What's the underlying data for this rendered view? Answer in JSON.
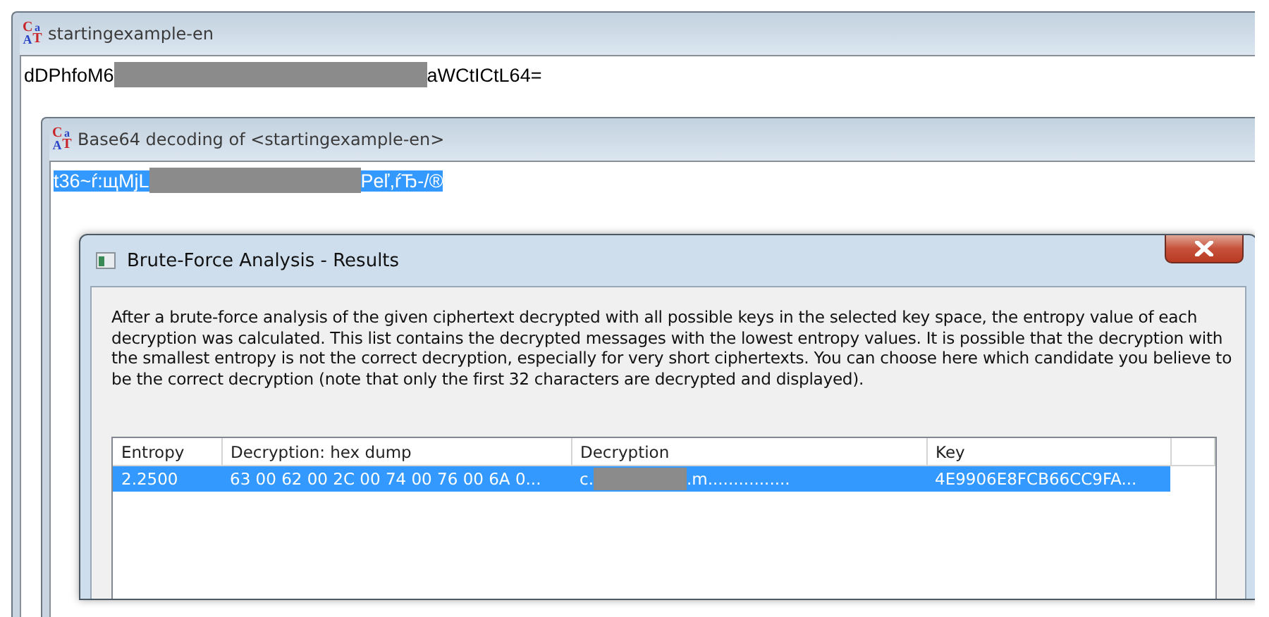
{
  "main_window": {
    "icon_letters": [
      "C",
      "a",
      "A",
      "T"
    ],
    "title": "startingexample-en",
    "content": {
      "kind": "redacted",
      "start": "dDPhfoM6",
      "end": "aWCtICtL64=",
      "selected": false
    }
  },
  "decoding_window": {
    "icon_letters": [
      "C",
      "a",
      "A",
      "T"
    ],
    "title": "Base64 decoding of <startingexample-en>",
    "content": {
      "kind": "redacted",
      "start": "t36~ŕ:щMjL",
      "end": "Peľ,ŕЂ-/®",
      "selected": true
    }
  },
  "dialog": {
    "title": "Brute-Force Analysis - Results",
    "description": "After a brute-force analysis of the given ciphertext decrypted with all possible keys in the selected key space, the entropy value of each decryption was calculated. This list contains the decrypted messages with the lowest entropy values. It is possible that the decryption with the smallest entropy is not the correct decryption, especially for very short ciphertexts. You can choose here which candidate you believe to be the correct decryption (note that only the first 32 characters are decrypted and displayed).",
    "table": {
      "columns": [
        "Entropy",
        "Decryption: hex dump",
        "Decryption",
        "Key"
      ],
      "rows": [
        {
          "selected": true,
          "cells": [
            {
              "kind": "text",
              "text": "2.2500"
            },
            {
              "kind": "text",
              "text": "63 00 62 00 2C 00 74 00 76 00 6A 0..."
            },
            {
              "kind": "redacted",
              "start": "c.",
              "end": ".m................"
            },
            {
              "kind": "text",
              "text": "4E9906E8FCB66CC9FA..."
            }
          ]
        }
      ]
    }
  }
}
